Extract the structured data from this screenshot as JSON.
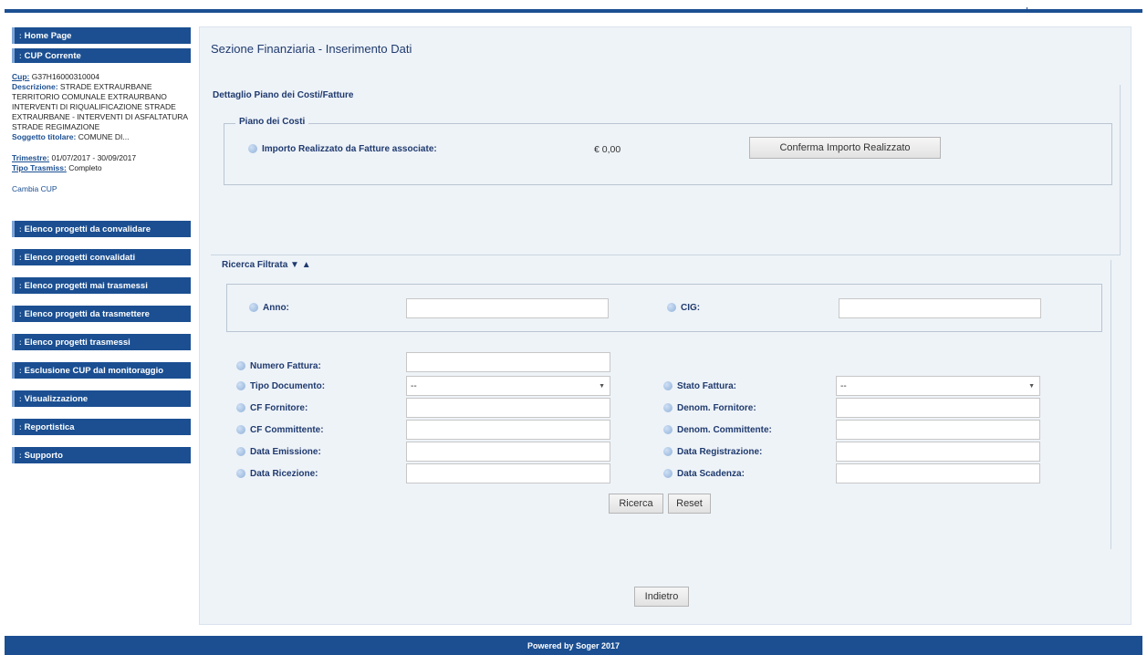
{
  "sidebar": {
    "home": "Home Page",
    "cup_corrente": "CUP Corrente",
    "cup_info": {
      "cup_label": "Cup:",
      "cup_value": "G37H16000310004",
      "descrizione_label": "Descrizione:",
      "descrizione_value": "STRADE EXTRAURBANE TERRITORIO COMUNALE EXTRAURBANO INTERVENTI DI RIQUALIFICAZIONE STRADE EXTRAURBANE - INTERVENTI DI ASFALTATURA STRADE REGIMAZIONE",
      "soggetto_label": "Soggetto titolare:",
      "soggetto_value": "COMUNE DI...",
      "trimestre_label": "Trimestre:",
      "trimestre_value": "01/07/2017 - 30/09/2017",
      "tipo_label": "Tipo Trasmiss:",
      "tipo_value": "Completo"
    },
    "cambia_cup": "Cambia CUP",
    "items": [
      "Elenco progetti da convalidare",
      "Elenco progetti convalidati",
      "Elenco progetti mai trasmessi",
      "Elenco progetti da trasmettere",
      "Elenco progetti trasmessi",
      "Esclusione CUP dal monitoraggio",
      "Visualizzazione",
      "Reportistica",
      "Supporto"
    ]
  },
  "main": {
    "title": "Sezione Finanziaria - Inserimento Dati",
    "dettaglio": {
      "title": "Dettaglio Piano dei Costi/Fatture",
      "legend": "Piano dei Costi",
      "importo_label": "Importo Realizzato da Fatture associate:",
      "importo_value": "€ 0,00",
      "conferma_button": "Conferma Importo Realizzato"
    },
    "ricerca": {
      "title": "Ricerca Filtrata ▼ ▲",
      "anno_label": "Anno:",
      "cig_label": "CIG:",
      "numero_fattura_label": "Numero Fattura:",
      "tipo_documento_label": "Tipo Documento:",
      "tipo_documento_value": "--",
      "stato_fattura_label": "Stato Fattura:",
      "stato_fattura_value": "--",
      "cf_fornitore_label": "CF Fornitore:",
      "denom_fornitore_label": "Denom. Fornitore:",
      "cf_committente_label": "CF Committente:",
      "denom_committente_label": "Denom. Committente:",
      "data_emissione_label": "Data Emissione:",
      "data_registrazione_label": "Data Registrazione:",
      "data_ricezione_label": "Data Ricezione:",
      "data_scadenza_label": "Data Scadenza:",
      "ricerca_button": "Ricerca",
      "reset_button": "Reset"
    },
    "indietro_button": "Indietro"
  },
  "footer": "Powered by Soger 2017",
  "colors": {
    "primary": "#1b4f92",
    "panel_bg": "#eef3f8"
  },
  "icons": {
    "field_bullet": "info-dot-icon"
  }
}
